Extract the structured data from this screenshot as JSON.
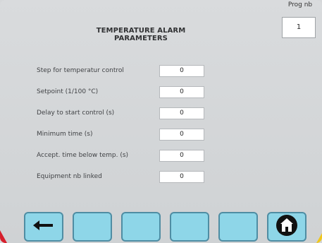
{
  "header": {
    "title": "TEMPERATURE ALARM PARAMETERS",
    "prog_label": "Prog nb",
    "prog_value": "1"
  },
  "params": [
    {
      "label": "Step for temperatur control",
      "value": "0"
    },
    {
      "label": "Setpoint (1/100 °C)",
      "value": "0"
    },
    {
      "label": "Delay to start control (s)",
      "value": "0"
    },
    {
      "label": "Minimum time (s)",
      "value": "0"
    },
    {
      "label": "Accept. time below temp. (s)",
      "value": "0"
    },
    {
      "label": "Equipment nb linked",
      "value": "0"
    }
  ],
  "footer": {
    "buttons": [
      "back-arrow-icon",
      "",
      "",
      "",
      "",
      "home-icon"
    ]
  },
  "colors": {
    "button_fill": "#8ed6e8",
    "button_border": "#4f8da3",
    "background": "#d6d8da"
  }
}
